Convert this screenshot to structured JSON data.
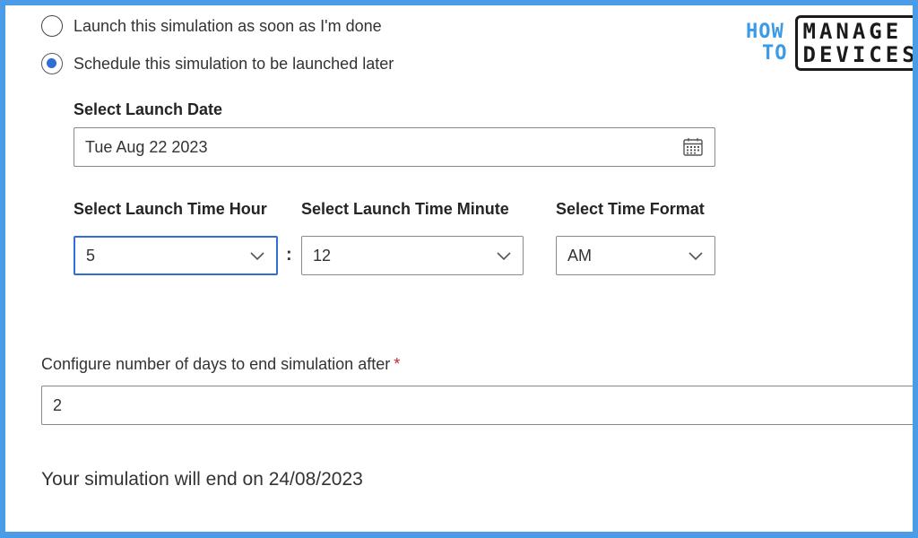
{
  "launch_options": {
    "now_label": "Launch this simulation as soon as I'm done",
    "later_label": "Schedule this simulation to be launched later",
    "selected": "later"
  },
  "launch_date": {
    "label": "Select Launch Date",
    "value": "Tue Aug 22 2023",
    "icon": "calendar-icon"
  },
  "launch_time": {
    "hour_label": "Select Launch Time Hour",
    "hour_value": "5",
    "separator": ":",
    "minute_label": "Select Launch Time Minute",
    "minute_value": "12",
    "format_label": "Select Time Format",
    "format_value": "AM"
  },
  "end_days": {
    "label": "Configure number of days to end simulation after",
    "required_marker": "*",
    "value": "2"
  },
  "end_summary": "Your simulation will end on 24/08/2023",
  "watermark": {
    "line1": "HOW",
    "line2": "TO",
    "box_line1": "MANAGE",
    "box_line2": "DEVICES"
  },
  "colors": {
    "accent": "#2f6fd1",
    "frame": "#4a9be8",
    "required": "#c4262e"
  }
}
